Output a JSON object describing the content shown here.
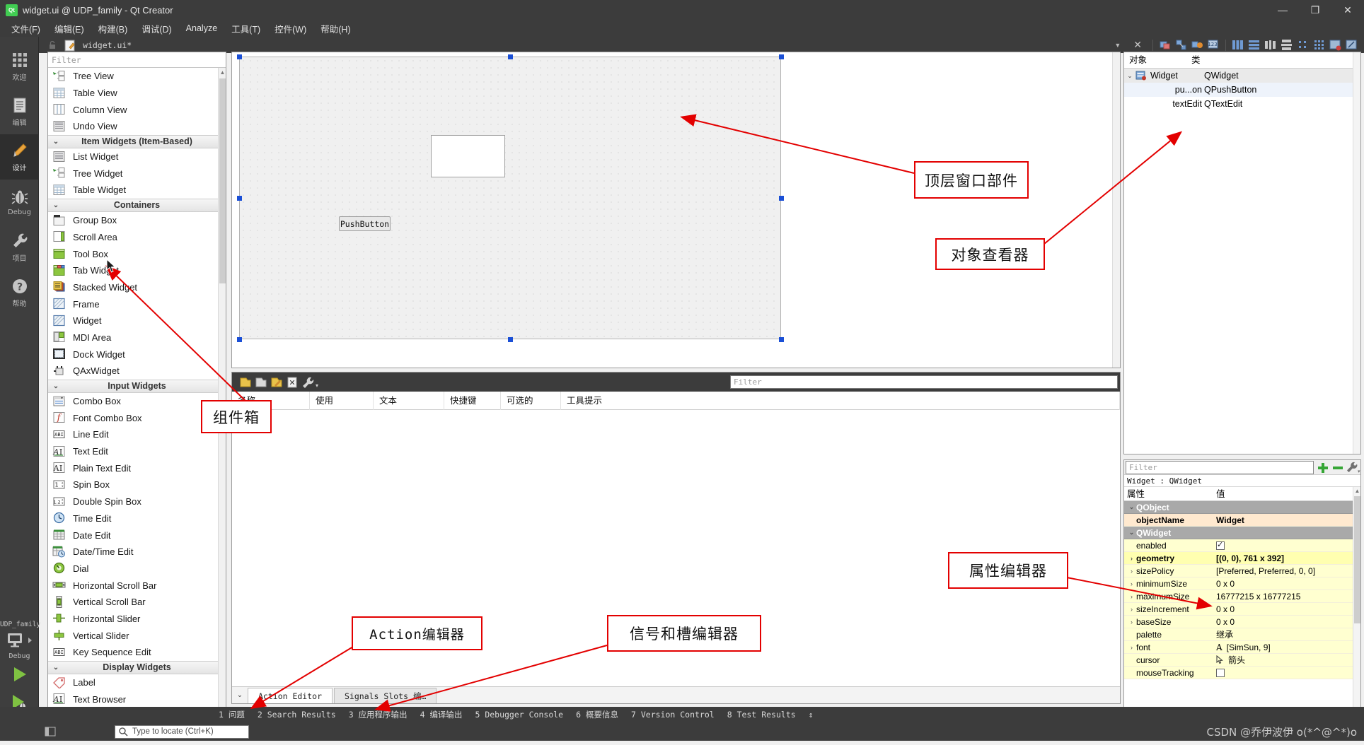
{
  "window": {
    "title": "widget.ui @ UDP_family - Qt Creator",
    "app_icon": "qt-logo-icon",
    "minimize": "—",
    "maximize": "❐",
    "close": "✕"
  },
  "menubar": {
    "items": [
      {
        "label": "文件(F)",
        "name": "menu-file"
      },
      {
        "label": "编辑(E)",
        "name": "menu-edit"
      },
      {
        "label": "构建(B)",
        "name": "menu-build"
      },
      {
        "label": "调试(D)",
        "name": "menu-debug"
      },
      {
        "label": "Analyze",
        "name": "menu-analyze"
      },
      {
        "label": "工具(T)",
        "name": "menu-tools"
      },
      {
        "label": "控件(W)",
        "name": "menu-window"
      },
      {
        "label": "帮助(H)",
        "name": "menu-help"
      }
    ]
  },
  "modebar": {
    "modes": [
      {
        "label": "欢迎",
        "icon": "grid-icon",
        "active": false
      },
      {
        "label": "编辑",
        "icon": "document-icon",
        "active": false
      },
      {
        "label": "设计",
        "icon": "pencil-icon",
        "active": true
      },
      {
        "label": "Debug",
        "icon": "bug-icon",
        "active": false
      },
      {
        "label": "项目",
        "icon": "wrench-icon",
        "active": false
      },
      {
        "label": "帮助",
        "icon": "question-icon",
        "active": false
      }
    ],
    "kit": {
      "project": "UDP_family",
      "build_config": "Debug",
      "monitor_icon": "monitor-icon",
      "run_icon": "run-play-icon",
      "debug_icon": "debug-play-icon",
      "build_icon": "hammer-icon"
    }
  },
  "editor_tabbar": {
    "lock_icon": "lock-icon",
    "file_icon": "ui-file-icon",
    "filename": "widget.ui*",
    "dropdown_icon": "chevron-down-icon",
    "close_icon": "close-icon",
    "tools": [
      "edit-widgets-icon",
      "edit-signals-slots-icon",
      "edit-buddies-icon",
      "edit-tab-order-icon",
      "layout-horizontal-icon",
      "layout-vertical-icon",
      "layout-splitter-h-icon",
      "layout-splitter-v-icon",
      "layout-form-icon",
      "layout-grid-icon",
      "break-layout-icon",
      "adjust-size-icon"
    ]
  },
  "widgetbox": {
    "filter_placeholder": "Filter",
    "rows": [
      {
        "type": "item",
        "label": "Tree View",
        "icon": "tree-view-icon"
      },
      {
        "type": "item",
        "label": "Table View",
        "icon": "table-view-icon"
      },
      {
        "type": "item",
        "label": "Column View",
        "icon": "column-view-icon"
      },
      {
        "type": "item",
        "label": "Undo View",
        "icon": "undo-view-icon"
      },
      {
        "type": "group",
        "label": "Item Widgets (Item-Based)"
      },
      {
        "type": "item",
        "label": "List Widget",
        "icon": "list-widget-icon"
      },
      {
        "type": "item",
        "label": "Tree Widget",
        "icon": "tree-widget-icon"
      },
      {
        "type": "item",
        "label": "Table Widget",
        "icon": "table-widget-icon"
      },
      {
        "type": "group",
        "label": "Containers"
      },
      {
        "type": "item",
        "label": "Group Box",
        "icon": "group-box-icon"
      },
      {
        "type": "item",
        "label": "Scroll Area",
        "icon": "scroll-area-icon"
      },
      {
        "type": "item",
        "label": "Tool Box",
        "icon": "tool-box-icon"
      },
      {
        "type": "item",
        "label": "Tab Widget",
        "icon": "tab-widget-icon"
      },
      {
        "type": "item",
        "label": "Stacked Widget",
        "icon": "stacked-widget-icon"
      },
      {
        "type": "item",
        "label": "Frame",
        "icon": "frame-icon"
      },
      {
        "type": "item",
        "label": "Widget",
        "icon": "widget-icon"
      },
      {
        "type": "item",
        "label": "MDI Area",
        "icon": "mdi-area-icon"
      },
      {
        "type": "item",
        "label": "Dock Widget",
        "icon": "dock-widget-icon"
      },
      {
        "type": "item",
        "label": "QAxWidget",
        "icon": "qax-widget-icon"
      },
      {
        "type": "group",
        "label": "Input Widgets"
      },
      {
        "type": "item",
        "label": "Combo Box",
        "icon": "combo-box-icon"
      },
      {
        "type": "item",
        "label": "Font Combo Box",
        "icon": "font-combo-box-icon"
      },
      {
        "type": "item",
        "label": "Line Edit",
        "icon": "line-edit-icon"
      },
      {
        "type": "item",
        "label": "Text Edit",
        "icon": "text-edit-icon"
      },
      {
        "type": "item",
        "label": "Plain Text Edit",
        "icon": "plain-text-edit-icon"
      },
      {
        "type": "item",
        "label": "Spin Box",
        "icon": "spin-box-icon"
      },
      {
        "type": "item",
        "label": "Double Spin Box",
        "icon": "double-spin-box-icon"
      },
      {
        "type": "item",
        "label": "Time Edit",
        "icon": "time-edit-icon"
      },
      {
        "type": "item",
        "label": "Date Edit",
        "icon": "date-edit-icon"
      },
      {
        "type": "item",
        "label": "Date/Time Edit",
        "icon": "date-time-edit-icon"
      },
      {
        "type": "item",
        "label": "Dial",
        "icon": "dial-icon"
      },
      {
        "type": "item",
        "label": "Horizontal Scroll Bar",
        "icon": "h-scrollbar-icon"
      },
      {
        "type": "item",
        "label": "Vertical Scroll Bar",
        "icon": "v-scrollbar-icon"
      },
      {
        "type": "item",
        "label": "Horizontal Slider",
        "icon": "h-slider-icon"
      },
      {
        "type": "item",
        "label": "Vertical Slider",
        "icon": "v-slider-icon"
      },
      {
        "type": "item",
        "label": "Key Sequence Edit",
        "icon": "key-sequence-edit-icon"
      },
      {
        "type": "group",
        "label": "Display Widgets"
      },
      {
        "type": "item",
        "label": "Label",
        "icon": "label-icon"
      },
      {
        "type": "item",
        "label": "Text Browser",
        "icon": "text-browser-icon"
      }
    ]
  },
  "form": {
    "pushbutton_label": "PushButton",
    "textedit_label": ""
  },
  "action_editor": {
    "filter_placeholder": "Filter",
    "toolbar_icons": [
      "new-action-icon",
      "copy-action-icon",
      "edit-action-icon",
      "delete-action-icon",
      "configure-icon"
    ],
    "columns": [
      "名称",
      "使用",
      "文本",
      "快捷键",
      "可选的",
      "工具提示"
    ],
    "rows": [],
    "tabs": [
      {
        "label": "Action Editor",
        "active": true
      },
      {
        "label": "Signals  Slots 编…",
        "active": false
      }
    ]
  },
  "object_inspector": {
    "columns": [
      "对象",
      "类"
    ],
    "rows": [
      {
        "name": "Widget",
        "class": "QWidget",
        "depth": 0,
        "icon": "widget-node-icon",
        "selected": true
      },
      {
        "name": "pu...on",
        "class": "QPushButton",
        "depth": 1,
        "icon": "",
        "selected": false
      },
      {
        "name": "textEdit",
        "class": "QTextEdit",
        "depth": 1,
        "icon": "",
        "selected": false
      }
    ]
  },
  "property_editor": {
    "filter_placeholder": "Filter",
    "add_icon": "plus-icon",
    "remove_icon": "minus-icon",
    "configure_icon": "wrench-icon",
    "object_line": "Widget : QWidget",
    "columns": [
      "属性",
      "值"
    ],
    "rows": [
      {
        "key": "QObject",
        "value": "",
        "style": "group",
        "expand": "v"
      },
      {
        "key": "objectName",
        "value": "Widget",
        "style": "hl",
        "expand": ""
      },
      {
        "key": "QWidget",
        "value": "",
        "style": "group",
        "expand": "v"
      },
      {
        "key": "enabled",
        "value": "",
        "style": "yel",
        "expand": "",
        "widget": "checkbox-checked"
      },
      {
        "key": "geometry",
        "value": "[(0, 0), 761 x 392]",
        "style": "yelb",
        "expand": ">"
      },
      {
        "key": "sizePolicy",
        "value": "[Preferred, Preferred, 0, 0]",
        "style": "yel",
        "expand": ">"
      },
      {
        "key": "minimumSize",
        "value": "0 x 0",
        "style": "yel",
        "expand": ">"
      },
      {
        "key": "maximumSize",
        "value": "16777215 x 16777215",
        "style": "yel",
        "expand": ">"
      },
      {
        "key": "sizeIncrement",
        "value": "0 x 0",
        "style": "yel",
        "expand": ">"
      },
      {
        "key": "baseSize",
        "value": "0 x 0",
        "style": "yel",
        "expand": ">"
      },
      {
        "key": "palette",
        "value": "继承",
        "style": "yel",
        "expand": ""
      },
      {
        "key": "font",
        "value": "[SimSun, 9]",
        "style": "yel",
        "expand": ">",
        "widget": "font-A-icon"
      },
      {
        "key": "cursor",
        "value": "箭头",
        "style": "yel",
        "expand": "",
        "widget": "cursor-arrow-icon"
      },
      {
        "key": "mouseTracking",
        "value": "",
        "style": "yel",
        "expand": "",
        "widget": "checkbox-empty"
      }
    ]
  },
  "output_panes": {
    "items": [
      {
        "num": "1",
        "label": "问题"
      },
      {
        "num": "2",
        "label": "Search Results"
      },
      {
        "num": "3",
        "label": "应用程序输出"
      },
      {
        "num": "4",
        "label": "编译输出"
      },
      {
        "num": "5",
        "label": "Debugger Console"
      },
      {
        "num": "6",
        "label": "概要信息"
      },
      {
        "num": "7",
        "label": "Version Control"
      },
      {
        "num": "8",
        "label": "Test Results"
      }
    ],
    "updown_icon": "updown-arrows-icon"
  },
  "statusbar": {
    "sidebar_toggle_icon": "sidebar-toggle-icon",
    "locator_placeholder": "Type to locate (Ctrl+K)",
    "locator_icon": "search-icon",
    "watermark": "CSDN @乔伊波伊 o(*^@^*)o"
  },
  "annotations": [
    {
      "text": "顶层窗口部件",
      "name": "annotation-top-level-widget"
    },
    {
      "text": "对象查看器",
      "name": "annotation-object-inspector"
    },
    {
      "text": "组件箱",
      "name": "annotation-widget-box"
    },
    {
      "text": "属性编辑器",
      "name": "annotation-property-editor"
    },
    {
      "text": "Action编辑器",
      "name": "annotation-action-editor"
    },
    {
      "text": "信号和槽编辑器",
      "name": "annotation-signal-slot-editor"
    }
  ],
  "colors": {
    "annotation_red": "#e30000",
    "chrome_dark": "#3c3c3c",
    "selection_blue": "#1a4fd6",
    "accent_green": "#41cd52"
  }
}
